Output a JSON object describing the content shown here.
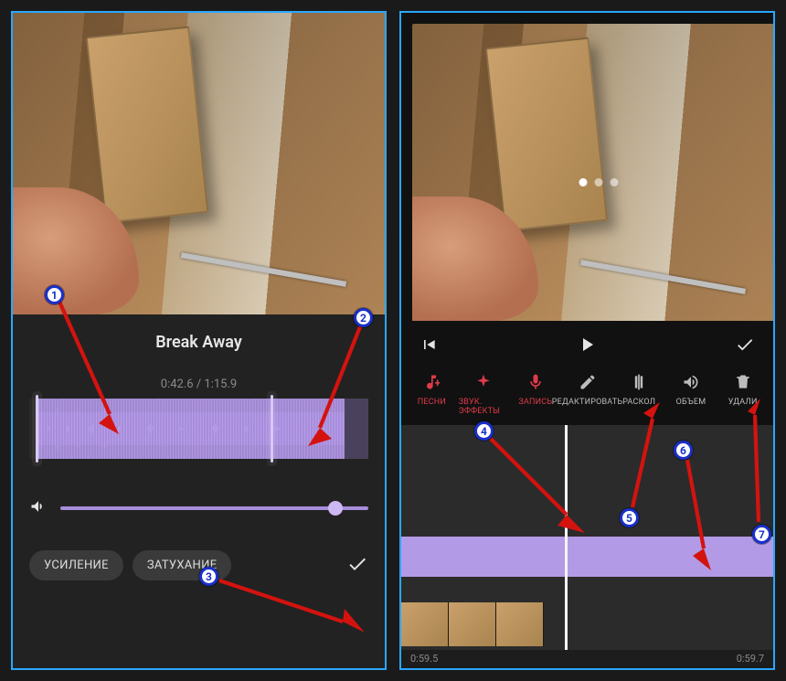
{
  "left": {
    "track_title": "Break Away",
    "time_current": "0:42.6",
    "time_total": "1:15.9",
    "timecode": "0:42.6 / 1:15.9",
    "chip_boost": "УСИЛЕНИЕ",
    "chip_fade": "ЗАТУХАНИЕ"
  },
  "right": {
    "tools": {
      "songs": "ПЕСНИ",
      "effects": "ЗВУК. ЭФФЕКТЫ",
      "record": "ЗАПИСЬ",
      "edit": "РЕДАКТИРОВАТЬ",
      "split": "РАСКОЛ",
      "volume": "ОБЪЕМ",
      "delete": "УДАЛИ"
    },
    "ruler_left": "0:59.5",
    "ruler_right": "0:59.7"
  },
  "badges": {
    "b1": "1",
    "b2": "2",
    "b3": "3",
    "b4": "4",
    "b5": "5",
    "b6": "6",
    "b7": "7"
  },
  "colors": {
    "accent": "#b39ae6",
    "frame": "#2aa7ff",
    "danger": "#e03a4a",
    "badge": "#1a2fca",
    "arrow": "#d4130f"
  }
}
